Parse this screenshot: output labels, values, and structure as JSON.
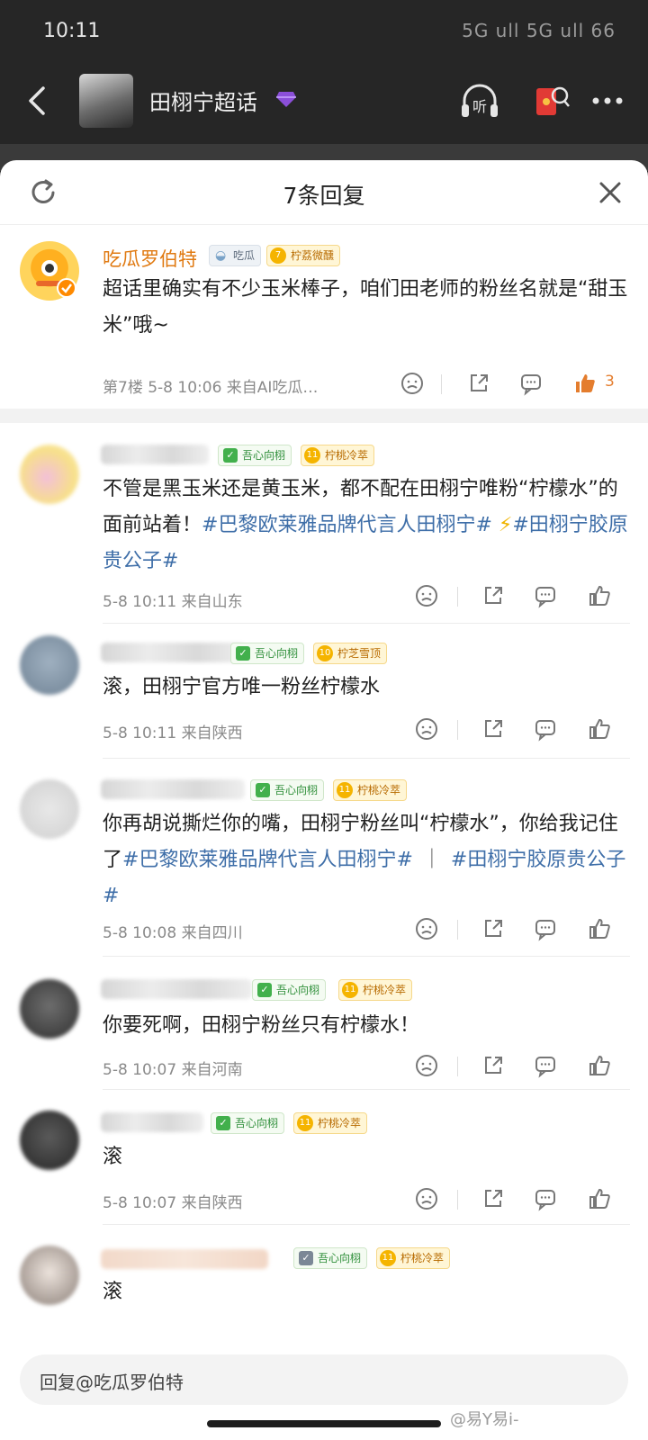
{
  "status_bar": {
    "time": "10:11",
    "indicators": "5G ull 5G ull 66"
  },
  "header": {
    "title": "田栩宁超话",
    "back_icon": "back-arrow-icon",
    "listen_label": "听"
  },
  "sheet": {
    "title": "7条回复"
  },
  "comments": [
    {
      "name": "吃瓜罗伯特",
      "badge_eat": "吃瓜",
      "badge_lemon_level": "7",
      "badge_lemon": "柠荔微醺",
      "text": "超话里确实有不少玉米棒子，咱们田老师的粉丝名就是“甜玉米”哦~",
      "meta": "第7楼  5-8 10:06  来自AI吃瓜…",
      "likes": "3"
    },
    {
      "badge_heart": "吾心向栩",
      "badge_lemon_level": "11",
      "badge_lemon": "柠桃冷萃",
      "text_plain": "不管是黑玉米还是黄玉米，都不配在田栩宁唯粉“柠檬水”的面前站着！",
      "tag1": "#巴黎欧莱雅品牌代言人田栩宁#",
      "spark": "⚡",
      "tag2": "#田栩宁胶原贵公子#",
      "meta": "5-8 10:11  来自山东"
    },
    {
      "badge_heart": "吾心向栩",
      "badge_lemon_level": "10",
      "badge_lemon": "柠芝雪顶",
      "text": "滚，田栩宁官方唯一粉丝柠檬水",
      "meta": "5-8 10:11  来自陕西"
    },
    {
      "badge_heart": "吾心向栩",
      "badge_lemon_level": "11",
      "badge_lemon": "柠桃冷萃",
      "text_plain": "你再胡说撕烂你的嘴，田栩宁粉丝叫“柠檬水”，你给我记住了",
      "tag1": "#巴黎欧莱雅品牌代言人田栩宁#",
      "sep": "｜",
      "tag2": "#田栩宁胶原贵公子#",
      "meta": "5-8 10:08  来自四川"
    },
    {
      "badge_heart": "吾心向栩",
      "badge_lemon_level": "11",
      "badge_lemon": "柠桃冷萃",
      "text": "你要死啊，田栩宁粉丝只有柠檬水！",
      "meta": "5-8 10:07  来自河南"
    },
    {
      "badge_heart": "吾心向栩",
      "badge_lemon_level": "11",
      "badge_lemon": "柠桃冷萃",
      "text": "滚",
      "meta": "5-8 10:07  来自陕西"
    },
    {
      "badge_heart": "吾心向栩",
      "badge_lemon_level": "11",
      "badge_lemon": "柠桃冷萃",
      "text": "滚"
    }
  ],
  "reply_bar": {
    "placeholder": "回复@吃瓜罗伯特"
  },
  "watermark": "@易Y易i-",
  "colors": {
    "accent_orange": "#e07a12",
    "hashtag_blue": "#3e6ea8",
    "badge_green": "#42b04c",
    "lemon_gold": "#f5b400"
  }
}
